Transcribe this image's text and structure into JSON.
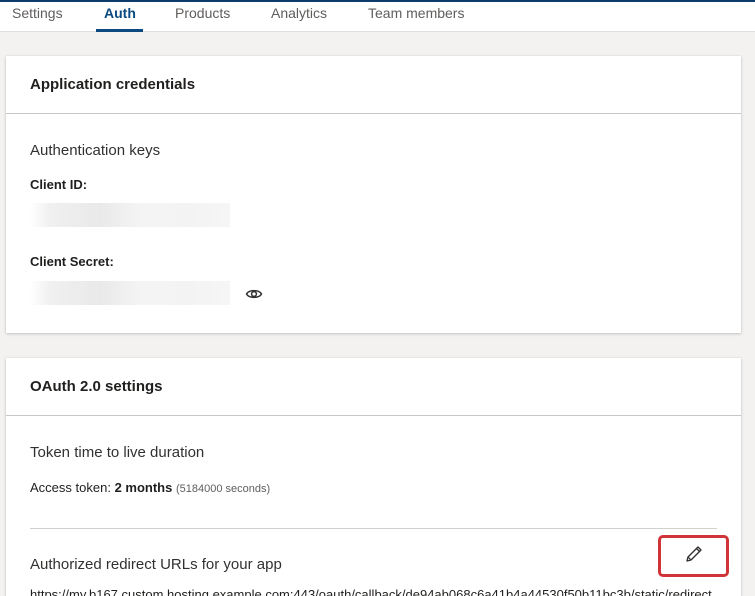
{
  "tabs": [
    {
      "label": "Settings"
    },
    {
      "label": "Auth"
    },
    {
      "label": "Products"
    },
    {
      "label": "Analytics"
    },
    {
      "label": "Team members"
    }
  ],
  "credentials": {
    "title": "Application credentials",
    "section_title": "Authentication keys",
    "client_id_label": "Client ID:",
    "client_secret_label": "Client Secret:"
  },
  "oauth": {
    "title": "OAuth 2.0 settings",
    "ttl_title": "Token time to live duration",
    "access_token_label": "Access token:",
    "access_token_value": "2 months",
    "access_token_seconds": "(5184000 seconds)",
    "redirect_title": "Authorized redirect URLs for your app",
    "redirect_url_partial": "https://my.b167.custom.hosting.example.com:443/oauth/callback/de94ab068c6a41b4a44530f50b11bc3b/static/redirect"
  },
  "icons": {
    "show_secret": "eye-icon",
    "edit": "pencil-icon"
  },
  "colors": {
    "accent": "#0a4a80",
    "highlight_border": "#d13438"
  }
}
